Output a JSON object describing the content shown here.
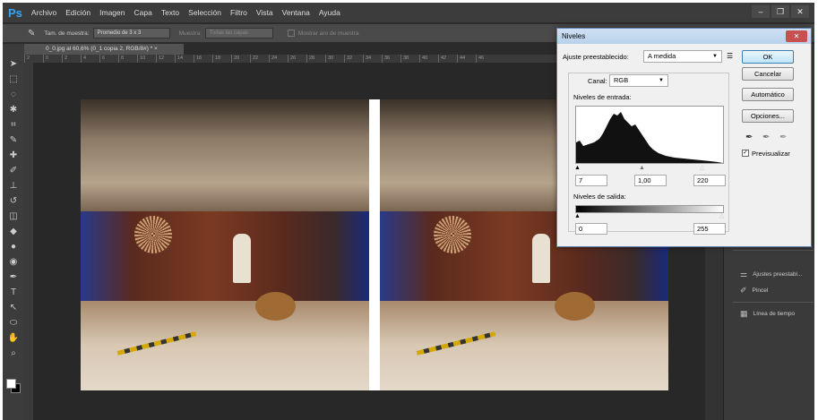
{
  "menubar": {
    "logo": "Ps",
    "items": [
      "Archivo",
      "Edición",
      "Imagen",
      "Capa",
      "Texto",
      "Selección",
      "Filtro",
      "Vista",
      "Ventana",
      "Ayuda"
    ],
    "window_buttons": [
      "–",
      "❐",
      "✕"
    ]
  },
  "options_bar": {
    "sample_size_label": "Tam. de muestra:",
    "sample_size_value": "Promedio de 3 x 3",
    "sample_label": "Muestra:",
    "sample_value": "Todas las capas",
    "ring_label": "Mostrar aro de muestra"
  },
  "document": {
    "tab_title": "0_0.jpg al 60,6% (0_1 copia 2, RGB/8#) * ×",
    "ruler_ticks": [
      "2",
      "0",
      "2",
      "4",
      "6",
      "8",
      "10",
      "12",
      "14",
      "16",
      "18",
      "20",
      "22",
      "24",
      "26",
      "28",
      "30",
      "32",
      "34",
      "36",
      "38",
      "40",
      "42",
      "44",
      "46"
    ]
  },
  "side_panel": {
    "items": [
      {
        "label": "Ajustes preestabl...",
        "icon": "adjustment-presets-icon"
      },
      {
        "label": "Pincel",
        "icon": "brush-icon"
      },
      {
        "label": "Línea de tiempo",
        "icon": "timeline-icon"
      }
    ]
  },
  "levels_dialog": {
    "title": "Niveles",
    "preset_label": "Ajuste preestablecido:",
    "preset_value": "A medida",
    "channel_label": "Canal:",
    "channel_value": "RGB",
    "input_levels_label": "Niveles de entrada:",
    "input_black": "7",
    "input_gamma": "1,00",
    "input_white": "220",
    "output_levels_label": "Niveles de salida:",
    "output_black": "0",
    "output_white": "255",
    "buttons": {
      "ok": "OK",
      "cancel": "Cancelar",
      "auto": "Automático",
      "options": "Opciones..."
    },
    "preview_label": "Previsualizar",
    "preview_checked": true
  }
}
